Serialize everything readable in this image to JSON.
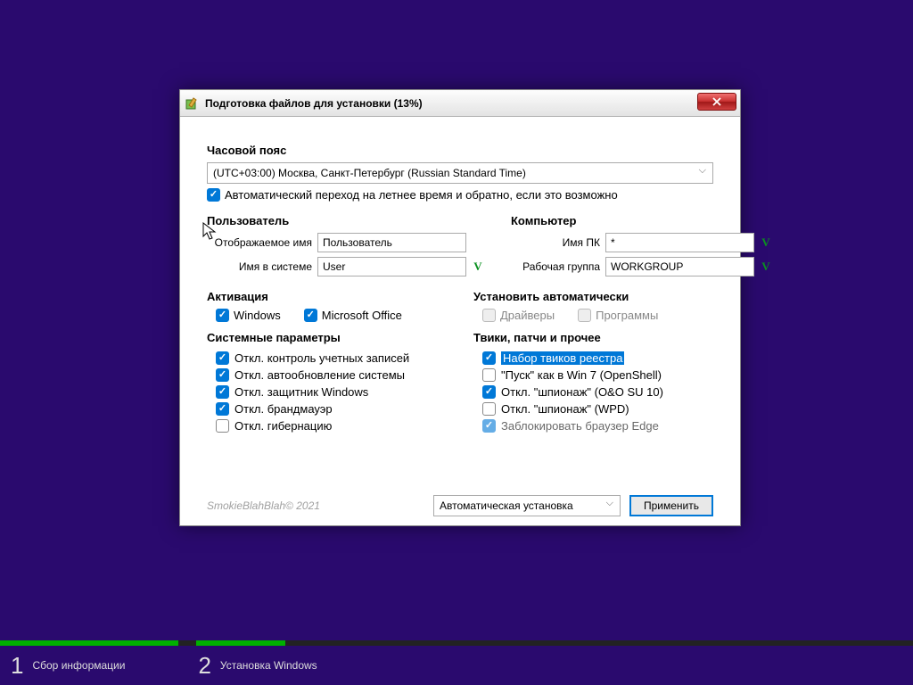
{
  "titlebar": {
    "title": "Подготовка файлов для установки (13%)"
  },
  "timezone": {
    "label": "Часовой пояс",
    "selected": "(UTC+03:00) Москва, Санкт-Петербург (Russian Standard Time)",
    "dst_checked": true,
    "dst_label": "Автоматический переход на летнее время и обратно, если это возможно"
  },
  "user": {
    "heading": "Пользователь",
    "display_name_label": "Отображаемое имя",
    "display_name_value": "Пользователь",
    "system_name_label": "Имя в системе",
    "system_name_value": "User",
    "system_name_valid": "V"
  },
  "computer": {
    "heading": "Компьютер",
    "pc_name_label": "Имя ПК",
    "pc_name_value": "*",
    "pc_name_valid": "V",
    "workgroup_label": "Рабочая группа",
    "workgroup_value": "WORKGROUP",
    "workgroup_valid": "V"
  },
  "activation": {
    "heading": "Активация",
    "windows": {
      "label": "Windows",
      "checked": true
    },
    "office": {
      "label": "Microsoft Office",
      "checked": true
    }
  },
  "autoinstall": {
    "heading": "Установить автоматически",
    "drivers": {
      "label": "Драйверы",
      "checked": false,
      "disabled": true
    },
    "programs": {
      "label": "Программы",
      "checked": false,
      "disabled": true
    }
  },
  "sysparams": {
    "heading": "Системные параметры",
    "items": [
      {
        "label": "Откл. контроль учетных записей",
        "checked": true
      },
      {
        "label": "Откл. автообновление системы",
        "checked": true
      },
      {
        "label": "Откл. защитник Windows",
        "checked": true
      },
      {
        "label": "Откл. брандмауэр",
        "checked": true
      },
      {
        "label": "Откл. гибернацию",
        "checked": false
      }
    ]
  },
  "tweaks": {
    "heading": "Твики, патчи и прочее",
    "items": [
      {
        "label": "Набор твиков реестра",
        "checked": true,
        "highlighted": true
      },
      {
        "label": "\"Пуск\" как в Win 7 (OpenShell)",
        "checked": false
      },
      {
        "label": "Откл. \"шпионаж\" (O&O SU 10)",
        "checked": true
      },
      {
        "label": "Откл. \"шпионаж\" (WPD)",
        "checked": false
      },
      {
        "label": "Заблокировать браузер Edge",
        "checked": true,
        "partial": true
      }
    ]
  },
  "footer": {
    "copyright": "SmokieBlahBlah© 2021",
    "mode": "Автоматическая установка",
    "apply": "Применить"
  },
  "steps": {
    "progress_pct_1": 100,
    "progress_pct_2": 13,
    "s1_num": "1",
    "s1_label": "Сбор информации",
    "s2_num": "2",
    "s2_label": "Установка Windows"
  }
}
